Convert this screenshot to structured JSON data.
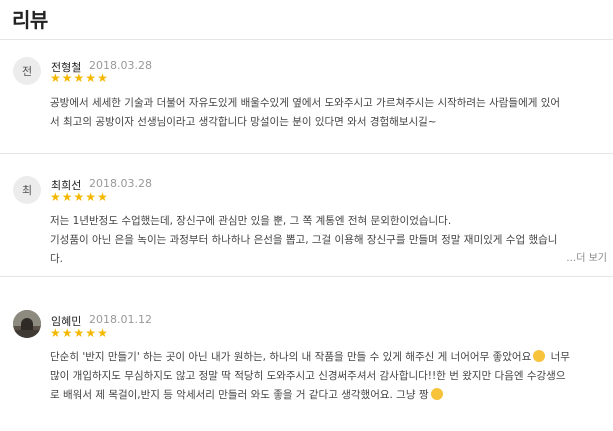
{
  "section": {
    "title": "리뷰"
  },
  "reviews": [
    {
      "avatar_text": "전",
      "name": "전형철",
      "date": "2018.03.28",
      "rating": 5,
      "lines": [
        "공방에서 세세한 기술과 더불어 자유도있게 배울수있게 옆에서 도와주시고 가르쳐주시는 시작하려는 사람들에게 있어",
        "서 최고의 공방이자 선생님이라고 생각합니다 망설이는 분이 있다면 와서 경험해보시길~"
      ]
    },
    {
      "avatar_text": "최",
      "name": "최희선",
      "date": "2018.03.28",
      "rating": 5,
      "lines": [
        "저는 1년반정도 수업했는데, 장신구에 관심만 있을 뿐, 그 쪽 계통엔 전혀 문외한이었습니다.",
        "기성품이 아닌 은을 녹이는 과정부터 하나하나 은선을 뽑고, 그걸 이용해 장신구를 만들며 정말 재미있게 수업 했습니",
        "다."
      ],
      "more_label": "…더 보기"
    },
    {
      "avatar_icon": "profile-photo",
      "name": "임혜민",
      "date": "2018.01.12",
      "rating": 5,
      "line1_part1": "단순히 '반지 만들기' 하는 곳이 아닌 내가 원하는, 하나의 내 작품을 만들 수 있게 해주신 게 너어어무 좋았어요",
      "line1_part2": " 너무",
      "line2": "많이 개입하지도 무심하지도 않고 정말 딱 적당히 도와주시고 신경써주셔서 감사합니다!!한 번 왔지만 다음엔 수강생으",
      "line3": "로 배워서 제 목걸이,반지 등 악세서리 만들러 와도 좋을 거 같다고 생각했어요. 그냥 짱",
      "emoji_icons": [
        "crying-face-emoji",
        "smiling-face-emoji"
      ]
    }
  ]
}
